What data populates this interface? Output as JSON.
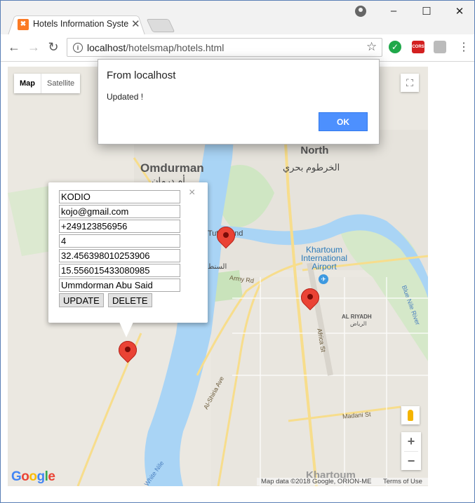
{
  "browser": {
    "tab_title": "Hotels Information Syste",
    "url_host": "localhost",
    "url_path": "/hotelsmap/hotels.html",
    "window_controls": [
      "–",
      "☐",
      "✕"
    ],
    "ext_cors": "CORS"
  },
  "map": {
    "map_types": [
      "Map",
      "Satellite"
    ],
    "active_map_type": "Map",
    "labels": {
      "omdurman": "Omdurman",
      "omdurman_ar": "أم درمان",
      "khartoum_north": "Khartoum\nNorth",
      "khartoum_north_ar": "الخرطوم بحري",
      "tuti_island": "Tuti Island",
      "airport": "Khartoum\nInternational\nAirport",
      "army_rd": "Army Rd",
      "africa_st": "Africa St",
      "al_shiria_ave": "Al-Shiria Ave",
      "madani_st": "Madani St",
      "al_riyadh": "AL RIYADH",
      "al_riyadh_ar": "الرياض",
      "blue_nile": "Blue Nile River",
      "white_nile": "White Nile",
      "khartoum": "Khartoum",
      "alsunt_ar": "السنط"
    },
    "attribution": "Map data ©2018 Google, ORION-ME",
    "terms": "Terms of Use",
    "zoom_in": "+",
    "zoom_out": "−"
  },
  "info_window": {
    "fields": [
      "KODIO",
      "kojo@gmail.com",
      "+249123856956",
      "4",
      "32.456398010253906",
      "15.556015433080985",
      "Ummdorman Abu Said"
    ],
    "update_label": "UPDATE",
    "delete_label": "DELETE",
    "close": "×"
  },
  "alert": {
    "title": "From localhost",
    "message": "Updated !",
    "ok_label": "OK"
  },
  "colors": {
    "marker": "#ea4335",
    "river": "#a9d4f5",
    "road": "#f7dd8c",
    "ok_button": "#4d90fe"
  }
}
